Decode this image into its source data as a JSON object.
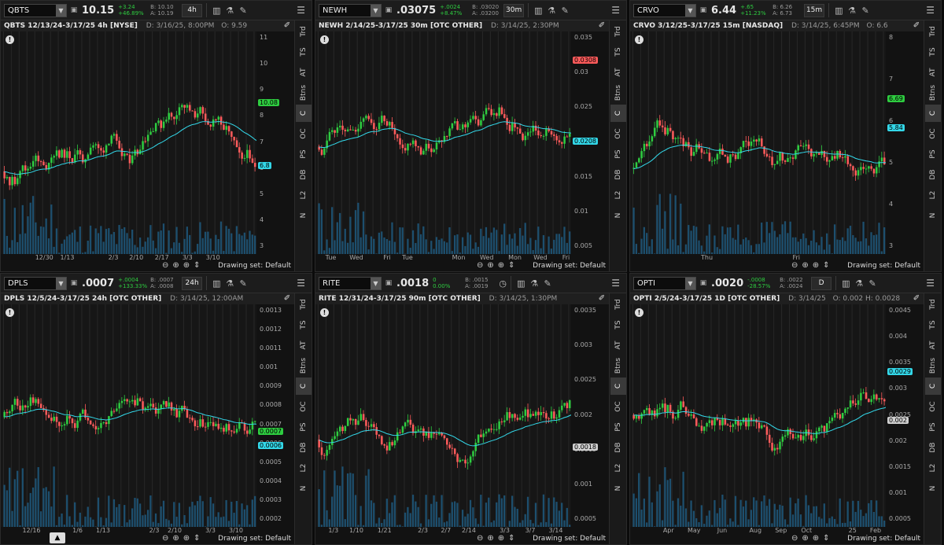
{
  "drawing_set": "Drawing set: Default",
  "sidebar": [
    "Trd",
    "TS",
    "AT",
    "Btns",
    "C",
    "OC",
    "PS",
    "DB",
    "L2",
    "N"
  ],
  "panels": [
    {
      "symbol": "QBTS",
      "price": "10.15",
      "chg1": "+3.24",
      "chg2": "+46.89%",
      "bid": "B: 10.10",
      "ask": "A: 10.19",
      "agg": "4h",
      "title": "QBTS 12/13/24-3/17/25 4h [NYSE]",
      "dline": "D: 3/16/25, 8:00PM",
      "oline": "O: 9.59",
      "y_ticks": [
        "11",
        "10",
        "9",
        "8",
        "7",
        "6",
        "5",
        "4",
        "3"
      ],
      "x_ticks": [
        "12/30",
        "1/13",
        "2/3",
        "2/10",
        "2/17",
        "3/3",
        "3/10"
      ],
      "tags": [
        {
          "text": "10.08",
          "color": "#2ecc40"
        },
        {
          "text": "6.8",
          "color": "#33d7e8"
        }
      ],
      "colors": {
        "up": "#2ecc40",
        "down": "#ff5b5b",
        "vwap": "#33d7e8"
      }
    },
    {
      "symbol": "NEWH",
      "price": ".03075",
      "chg1": "+.0024",
      "chg2": "+8.47%",
      "bid": "B: .03020",
      "ask": "A: .03200",
      "agg": "30m",
      "title": "NEWH 2/14/25-3/17/25 30m [OTC OTHER]",
      "dline": "D: 3/14/25, 2:30PM",
      "oline": "",
      "y_ticks": [
        "0.035",
        "0.03",
        "0.025",
        "0.02",
        "0.015",
        "0.01",
        "0.005"
      ],
      "x_ticks": [
        "Tue",
        "Wed",
        "Fri",
        "Tue",
        "Mon",
        "Wed",
        "Mon",
        "Wed",
        "Fri"
      ],
      "tags": [
        {
          "text": "0.0308",
          "color": "#ff5b5b"
        },
        {
          "text": "0.0208",
          "color": "#33d7e8"
        }
      ],
      "colors": {
        "up": "#2ecc40",
        "down": "#ff5b5b",
        "vwap": "#33d7e8"
      }
    },
    {
      "symbol": "CRVO",
      "price": "6.44",
      "chg1": "+.65",
      "chg2": "+11.23%",
      "bid": "B: 6.26",
      "ask": "A: 6.73",
      "agg": "15m",
      "title": "CRVO 3/12/25-3/17/25 15m [NASDAQ]",
      "dline": "D: 3/14/25, 6:45PM",
      "oline": "O: 6.6",
      "y_ticks": [
        "8",
        "7",
        "6",
        "5",
        "4",
        "3"
      ],
      "x_ticks": [
        "Thu",
        "Fri"
      ],
      "tags": [
        {
          "text": "6.69",
          "color": "#2ecc40"
        },
        {
          "text": "5.84",
          "color": "#33d7e8"
        }
      ],
      "colors": {
        "up": "#2ecc40",
        "down": "#ff5b5b",
        "vwap": "#33d7e8"
      }
    },
    {
      "symbol": "DPLS",
      "price": ".0007",
      "chg1": "+.0004",
      "chg2": "+133.33%",
      "bid": "B: .0007",
      "ask": "A: .0008",
      "agg": "24h",
      "title": "DPLS 12/5/24-3/17/25 24h [OTC OTHER]",
      "dline": "D: 3/14/25, 12:00AM",
      "oline": "",
      "y_ticks": [
        "0.0013",
        "0.0012",
        "0.0011",
        "0.001",
        "0.0009",
        "0.0008",
        "0.0007",
        "0.0006",
        "0.0005",
        "0.0004",
        "0.0003",
        "0.0002"
      ],
      "x_ticks": [
        "12/16",
        "1/6",
        "1/13",
        "2/3",
        "2/10",
        "3/3",
        "3/10"
      ],
      "tags": [
        {
          "text": "0.0007",
          "color": "#2ecc40"
        },
        {
          "text": "0.0006",
          "color": "#33d7e8"
        }
      ],
      "colors": {
        "up": "#2ecc40",
        "down": "#ff5b5b",
        "vwap": "#33d7e8"
      }
    },
    {
      "symbol": "RITE",
      "price": ".0018",
      "chg1": "0",
      "chg2": "0.00%",
      "bid": "B: .0015",
      "ask": "A: .0019",
      "agg": "",
      "title": "RITE 12/31/24-3/17/25 90m [OTC OTHER]",
      "dline": "D: 3/14/25, 1:30PM",
      "oline": "",
      "y_ticks": [
        "0.0035",
        "0.003",
        "0.0025",
        "0.002",
        "0.0015",
        "0.001",
        "0.0005"
      ],
      "x_ticks": [
        "1/3",
        "1/10",
        "1/21",
        "2/3",
        "2/7",
        "2/14",
        "3/3",
        "3/7",
        "3/14"
      ],
      "tags": [
        {
          "text": "0.0018",
          "color": "#cfcfcf"
        }
      ],
      "colors": {
        "up": "#2ecc40",
        "down": "#ff5b5b",
        "vwap": "#33d7e8"
      }
    },
    {
      "symbol": "OPTI",
      "price": ".0020",
      "chg1": "-.0008",
      "chg2": "-28.57%",
      "bid": "B: .0022",
      "ask": "A: .0024",
      "agg": "D",
      "title": "OPTI 2/5/24-3/17/25 1D [OTC OTHER]",
      "dline": "D: 3/14/25",
      "oline": "O: 0.002   H: 0.0028",
      "y_ticks": [
        "0.0045",
        "0.004",
        "0.0035",
        "0.003",
        "0.0025",
        "0.002",
        "0.0015",
        "0.001",
        "0.0005"
      ],
      "x_ticks": [
        "Apr",
        "May",
        "Jun",
        "Aug",
        "Sep",
        "Oct",
        "25",
        "Feb"
      ],
      "tags": [
        {
          "text": "0.0029",
          "color": "#33d7e8"
        },
        {
          "text": "0.002",
          "color": "#cfcfcf"
        }
      ],
      "colors": {
        "up": "#2ecc40",
        "down": "#ff5b5b",
        "vwap": "#33d7e8"
      }
    }
  ]
}
